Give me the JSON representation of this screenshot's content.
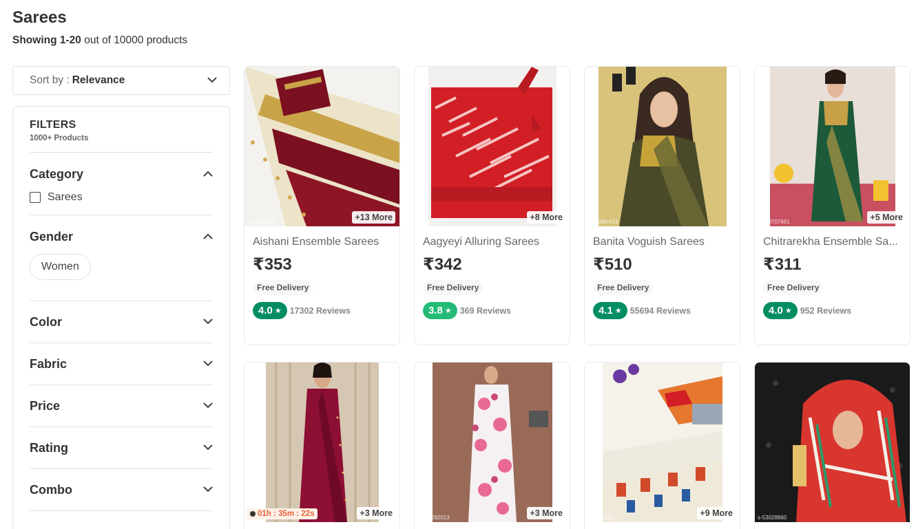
{
  "header": {
    "title": "Sarees",
    "count_bold": "Showing 1-20",
    "count_rest": " out of 10000 products"
  },
  "sort": {
    "label": "Sort by :",
    "value": "Relevance"
  },
  "filters": {
    "title": "FILTERS",
    "count": "1000+ Products",
    "category": {
      "name": "Category",
      "option": "Sarees"
    },
    "gender": {
      "name": "Gender",
      "option": "Women"
    },
    "collapsed": [
      "Color",
      "Fabric",
      "Price",
      "Rating",
      "Combo"
    ]
  },
  "colors": {
    "rating_dark": "#038d63",
    "rating_light": "#23bb75",
    "timer": "#e8633a"
  },
  "products": [
    {
      "name": "Aishani Ensemble Sarees",
      "price": "₹353",
      "delivery": "Free Delivery",
      "rating": "4.0",
      "reviews": "17302 Reviews",
      "more": "+13 More",
      "sku": "s-56676332",
      "rating_color": "#038d63",
      "icon": "saree-photo-cream-maroon"
    },
    {
      "name": "Aagyeyi Alluring Sarees",
      "price": "₹342",
      "delivery": "Free Delivery",
      "rating": "3.8",
      "reviews": "369 Reviews",
      "more": "+8 More",
      "sku": "s-468571775",
      "rating_color": "#23bb75",
      "icon": "saree-photo-red-leheriya"
    },
    {
      "name": "Banita Voguish Sarees",
      "price": "₹510",
      "delivery": "Free Delivery",
      "rating": "4.1",
      "reviews": "55694 Reviews",
      "more": "",
      "sku": "s-50089:613",
      "rating_color": "#038d63",
      "icon": "saree-photo-model-olive"
    },
    {
      "name": "Chitrarekha Ensemble Sa...",
      "price": "₹311",
      "delivery": "Free Delivery",
      "rating": "4.0",
      "reviews": "952 Reviews",
      "more": "+5 More",
      "sku": "s-528707661",
      "rating_color": "#038d63",
      "icon": "saree-photo-model-green"
    },
    {
      "name": "",
      "price": "",
      "delivery": "",
      "rating": "",
      "reviews": "",
      "more": "+3 More",
      "sku": "",
      "timer": "01h : 35m : 22s",
      "icon": "saree-photo-model-wine"
    },
    {
      "name": "",
      "price": "",
      "delivery": "",
      "rating": "",
      "reviews": "",
      "more": "+3 More",
      "sku": "s-406282013",
      "icon": "saree-photo-model-pink-floral"
    },
    {
      "name": "",
      "price": "",
      "delivery": "",
      "rating": "",
      "reviews": "",
      "more": "+9 More",
      "sku": "s-3242183",
      "icon": "saree-photo-white-printed"
    },
    {
      "name": "",
      "price": "",
      "delivery": "",
      "rating": "",
      "reviews": "",
      "more": "",
      "sku": "s-53028860",
      "icon": "saree-photo-model-bandhani"
    }
  ]
}
